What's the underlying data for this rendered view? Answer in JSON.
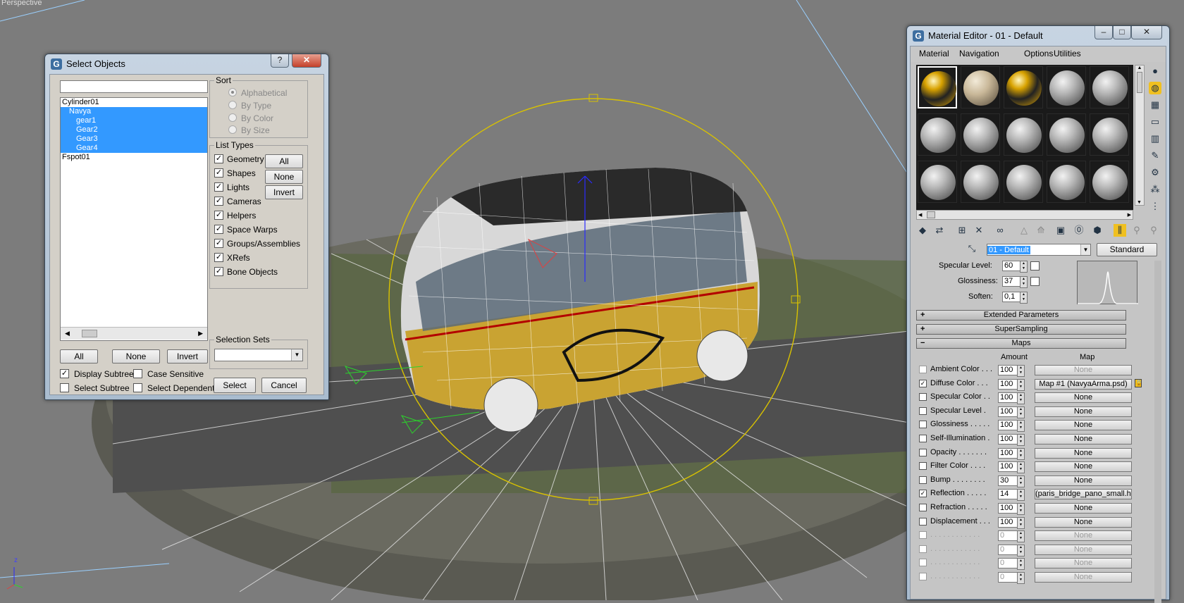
{
  "viewport": {
    "label": "Perspective",
    "gizmo_axis": "z"
  },
  "select_objects": {
    "title": "Select Objects",
    "search_value": "",
    "objects": [
      {
        "name": "Cylinder01",
        "indent": 0,
        "selected": false
      },
      {
        "name": "Navya",
        "indent": 1,
        "selected": true
      },
      {
        "name": "gear1",
        "indent": 2,
        "selected": true
      },
      {
        "name": "Gear2",
        "indent": 2,
        "selected": true
      },
      {
        "name": "Gear3",
        "indent": 2,
        "selected": true
      },
      {
        "name": "Gear4",
        "indent": 2,
        "selected": true
      },
      {
        "name": "Fspot01",
        "indent": 0,
        "selected": false
      }
    ],
    "sort": {
      "legend": "Sort",
      "options": [
        "Alphabetical",
        "By Type",
        "By Color",
        "By Size"
      ],
      "selected": "Alphabetical"
    },
    "list_types": {
      "legend": "List Types",
      "items": [
        "Geometry",
        "Shapes",
        "Lights",
        "Cameras",
        "Helpers",
        "Space Warps",
        "Groups/Assemblies",
        "XRefs",
        "Bone Objects"
      ],
      "all_label": "All",
      "none_label": "None",
      "invert_label": "Invert"
    },
    "bottom_buttons": {
      "all": "All",
      "none": "None",
      "invert": "Invert"
    },
    "options": {
      "display_subtree": "Display Subtree",
      "case_sensitive": "Case Sensitive",
      "select_subtree": "Select Subtree",
      "select_dependents": "Select Dependents"
    },
    "selection_sets": {
      "legend": "Selection Sets",
      "value": ""
    },
    "select_label": "Select",
    "cancel_label": "Cancel"
  },
  "material_editor": {
    "title": "Material Editor - 01 - Default",
    "menu": [
      "Material",
      "Navigation",
      "Options",
      "Utilities"
    ],
    "material_name": "01 - Default",
    "material_type": "Standard",
    "specular": {
      "level_label": "Specular Level:",
      "level_value": "60",
      "gloss_label": "Glossiness:",
      "gloss_value": "37",
      "soften_label": "Soften:",
      "soften_value": "0,1"
    },
    "rollouts": {
      "extended": "Extended Parameters",
      "supersampling": "SuperSampling",
      "maps": "Maps"
    },
    "maps_header": {
      "amount": "Amount",
      "map": "Map"
    },
    "maps": [
      {
        "label": "Ambient Color . . .",
        "checked": false,
        "amount": "100",
        "map": "None",
        "disabled": true
      },
      {
        "label": "Diffuse Color . . .",
        "checked": true,
        "amount": "100",
        "map": "Map #1 (NavyaArma.psd)",
        "disabled": false
      },
      {
        "label": "Specular Color . .",
        "checked": false,
        "amount": "100",
        "map": "None",
        "disabled": false
      },
      {
        "label": "Specular Level .",
        "checked": false,
        "amount": "100",
        "map": "None",
        "disabled": false
      },
      {
        "label": "Glossiness . . . . .",
        "checked": false,
        "amount": "100",
        "map": "None",
        "disabled": false
      },
      {
        "label": "Self-Illumination .",
        "checked": false,
        "amount": "100",
        "map": "None",
        "disabled": false
      },
      {
        "label": "Opacity . . . . . . .",
        "checked": false,
        "amount": "100",
        "map": "None",
        "disabled": false
      },
      {
        "label": "Filter Color . . . .",
        "checked": false,
        "amount": "100",
        "map": "None",
        "disabled": false
      },
      {
        "label": "Bump . . . . . . . .",
        "checked": false,
        "amount": "30",
        "map": "None",
        "disabled": false
      },
      {
        "label": "Reflection . . . . .",
        "checked": true,
        "amount": "14",
        "map": "(paris_bridge_pano_small.hdr)",
        "disabled": false
      },
      {
        "label": "Refraction . . . . .",
        "checked": false,
        "amount": "100",
        "map": "None",
        "disabled": false
      },
      {
        "label": "Displacement . . .",
        "checked": false,
        "amount": "100",
        "map": "None",
        "disabled": false
      },
      {
        "label": ". . . . . . . . . . . .",
        "checked": false,
        "amount": "0",
        "map": "None",
        "disabled": true
      },
      {
        "label": ". . . . . . . . . . . .",
        "checked": false,
        "amount": "0",
        "map": "None",
        "disabled": true
      },
      {
        "label": ". . . . . . . . . . . .",
        "checked": false,
        "amount": "0",
        "map": "None",
        "disabled": true
      },
      {
        "label": ". . . . . . . . . . . .",
        "checked": false,
        "amount": "0",
        "map": "None",
        "disabled": true
      }
    ]
  }
}
